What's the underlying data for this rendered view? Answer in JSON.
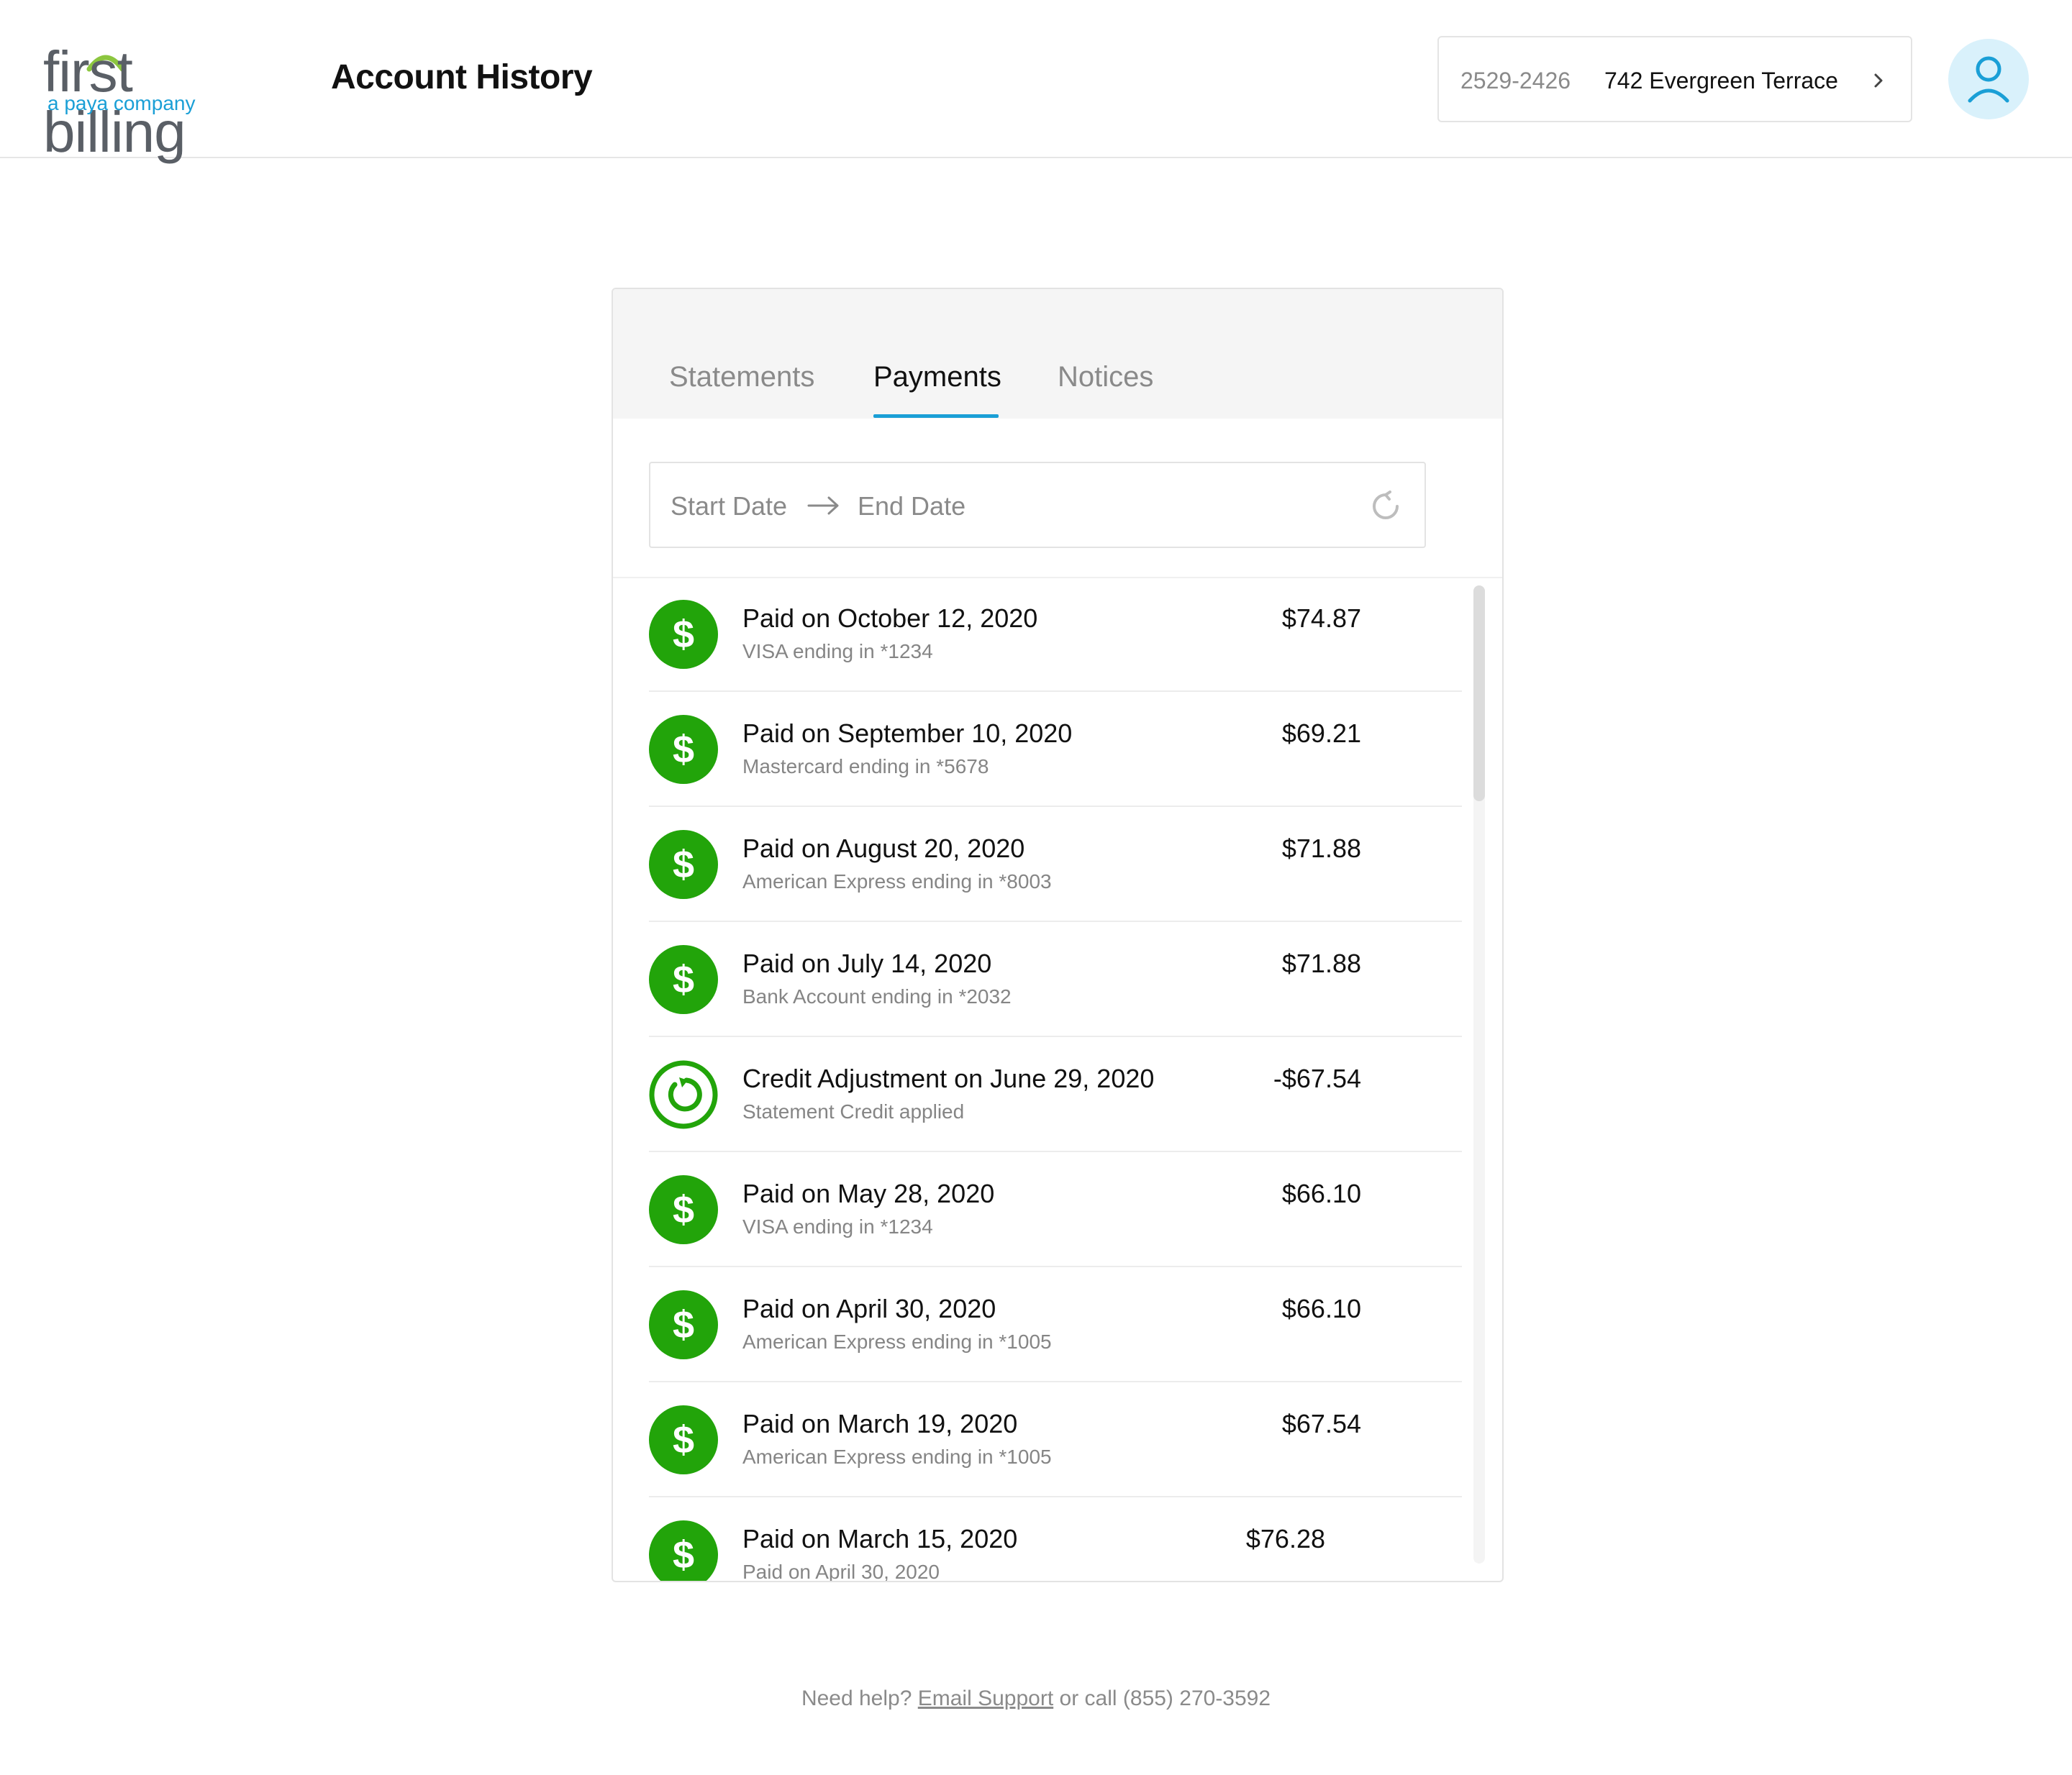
{
  "header": {
    "logo_text": "first billing",
    "logo_subtitle": "a paya company",
    "page_title": "Account History",
    "account_number": "2529-2426",
    "account_address": "742 Evergreen Terrace"
  },
  "tabs": [
    {
      "label": "Statements",
      "active": false
    },
    {
      "label": "Payments",
      "active": true
    },
    {
      "label": "Notices",
      "active": false
    }
  ],
  "date_range": {
    "start_placeholder": "Start Date",
    "end_placeholder": "End Date"
  },
  "transactions": [
    {
      "type": "payment",
      "title": "Paid on October 12, 2020",
      "subtitle": "VISA ending in *1234",
      "amount": "$74.87"
    },
    {
      "type": "payment",
      "title": "Paid on September 10, 2020",
      "subtitle": "Mastercard ending in *5678",
      "amount": "$69.21"
    },
    {
      "type": "payment",
      "title": "Paid on August 20, 2020",
      "subtitle": "American Express ending in *8003",
      "amount": "$71.88"
    },
    {
      "type": "payment",
      "title": "Paid on July 14, 2020",
      "subtitle": "Bank Account ending in *2032",
      "amount": "$71.88"
    },
    {
      "type": "credit",
      "title": "Credit Adjustment on June 29, 2020",
      "subtitle": "Statement Credit applied",
      "amount": "-$67.54"
    },
    {
      "type": "payment",
      "title": "Paid on May 28, 2020",
      "subtitle": "VISA ending in *1234",
      "amount": "$66.10"
    },
    {
      "type": "payment",
      "title": "Paid on April 30, 2020",
      "subtitle": "American Express ending in *1005",
      "amount": "$66.10"
    },
    {
      "type": "payment",
      "title": "Paid on March 19, 2020",
      "subtitle": "American Express ending in *1005",
      "amount": "$67.54"
    },
    {
      "type": "payment",
      "title": "Paid on March 15, 2020",
      "subtitle": "Paid on April 30, 2020",
      "amount": "$76.28"
    }
  ],
  "footer": {
    "prefix": "Need help?",
    "link": "Email Support",
    "suffix": "or call (855) 270-3592"
  },
  "colors": {
    "accent": "#1a9fd6",
    "payment_green": "#22a40a",
    "avatar_bg": "#d9f1fb"
  },
  "icons": {
    "payment": "dollar-circle-icon",
    "credit": "refresh-circle-icon"
  }
}
